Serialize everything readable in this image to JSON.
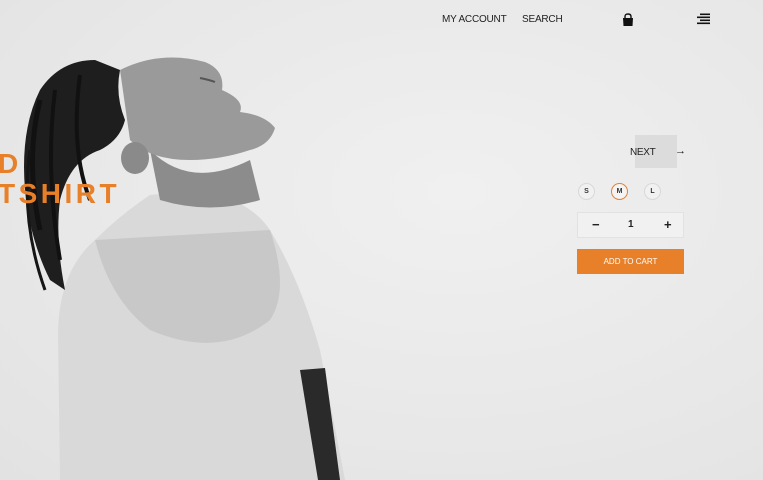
{
  "nav": {
    "account": "MY ACCOUNT",
    "search": "SEARCH"
  },
  "icons": {
    "bag": "shopping-bag-icon",
    "menu": "hamburger-menu-icon",
    "next": "arrow-right-icon"
  },
  "product": {
    "title_line1": "D",
    "title_line2": "TSHIRT"
  },
  "slider": {
    "next_label": "NEXT",
    "next_arrow": "→"
  },
  "sizes": [
    "S",
    "M",
    "L"
  ],
  "selected_size": "M",
  "quantity": {
    "minus": "−",
    "value": "1",
    "plus": "+"
  },
  "cart": {
    "label": "ADD TO CART"
  },
  "colors": {
    "accent": "#e8802a",
    "background": "#ececec"
  }
}
